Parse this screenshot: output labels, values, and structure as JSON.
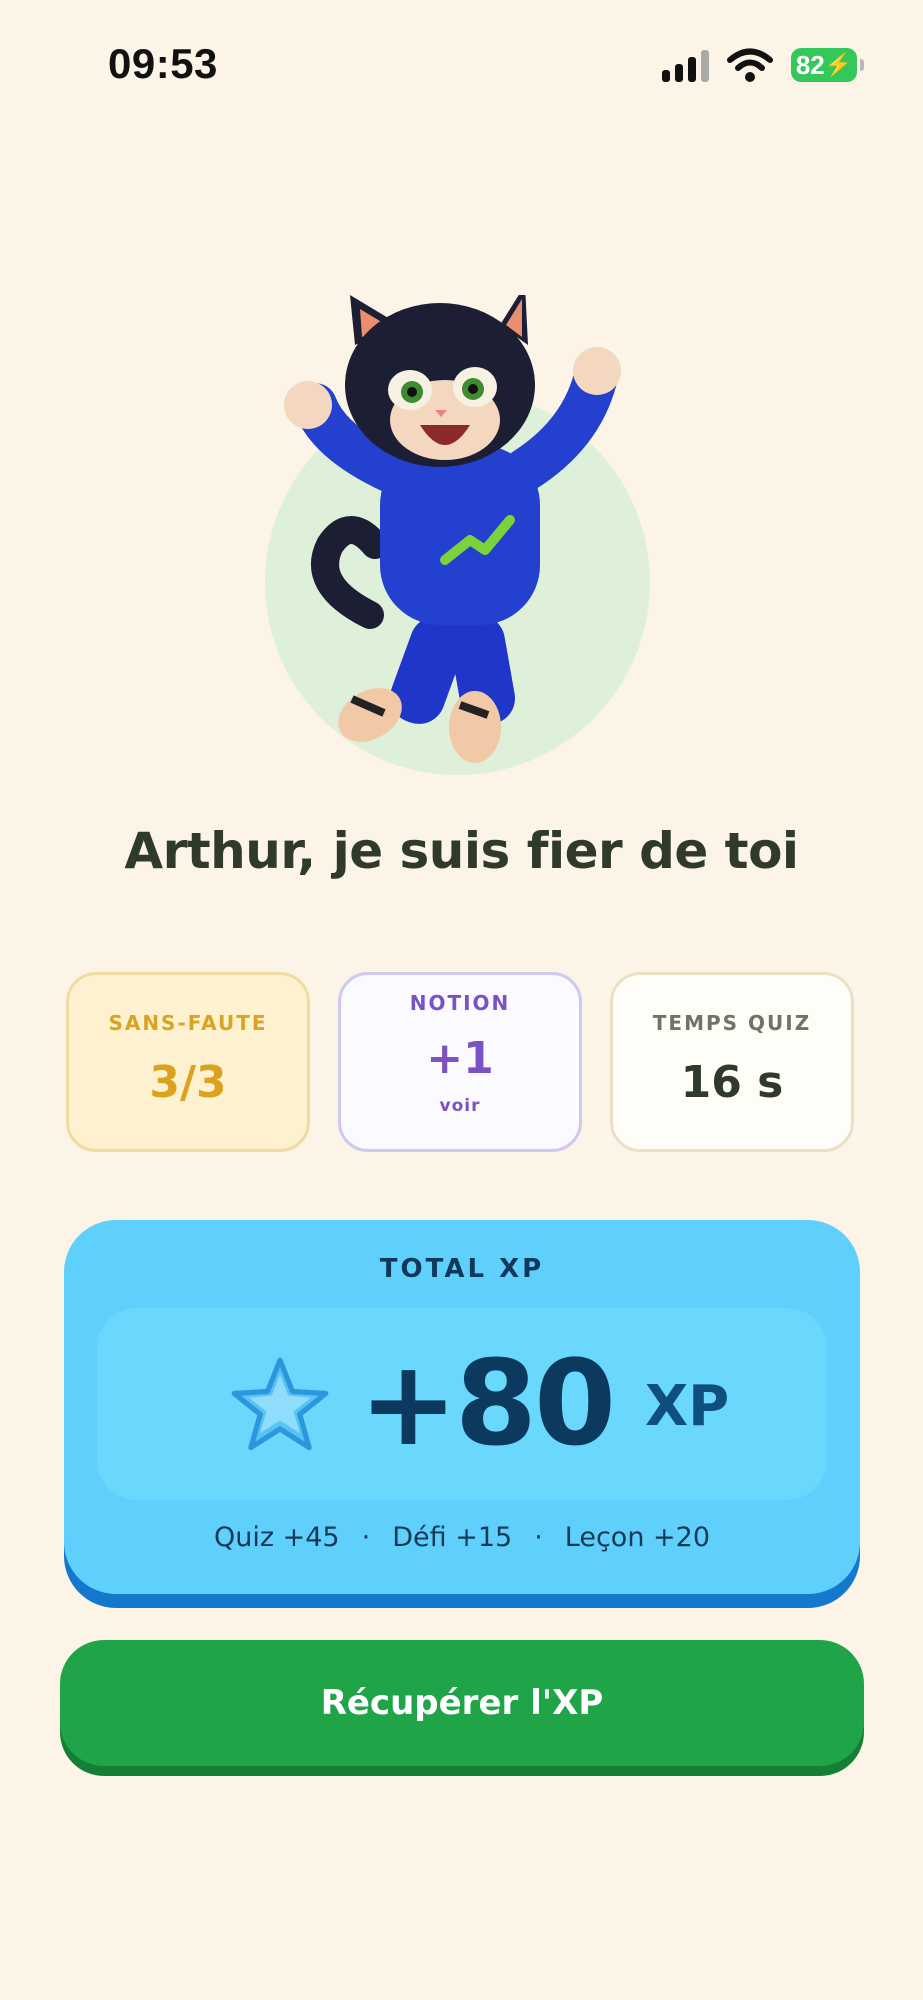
{
  "status_bar": {
    "time": "09:53",
    "battery": "82"
  },
  "headline": "Arthur, je suis fier de toi",
  "stats": [
    {
      "label": "SANS-FAUTE",
      "value": "3/3"
    },
    {
      "label": "NOTION",
      "value": "+1",
      "link": "voir"
    },
    {
      "label": "TEMPS QUIZ",
      "value": "16 s"
    }
  ],
  "xp": {
    "title": "TOTAL XP",
    "amount": "+80",
    "unit": "XP",
    "breakdown": [
      "Quiz +45",
      "Défi +15",
      "Leçon +20"
    ],
    "separator": "·"
  },
  "cta": {
    "label": "Récupérer l'XP"
  },
  "icons": {
    "mascot": "cat-mascot-icon",
    "star": "star-icon",
    "signal": "signal-icon",
    "wifi": "wifi-icon",
    "battery": "battery-icon"
  },
  "colors": {
    "background": "#fbf4e7",
    "accent_green": "#1fa448",
    "xp_blue": "#5fd0fb",
    "gold": "#dba220",
    "purple": "#7b52c2"
  }
}
